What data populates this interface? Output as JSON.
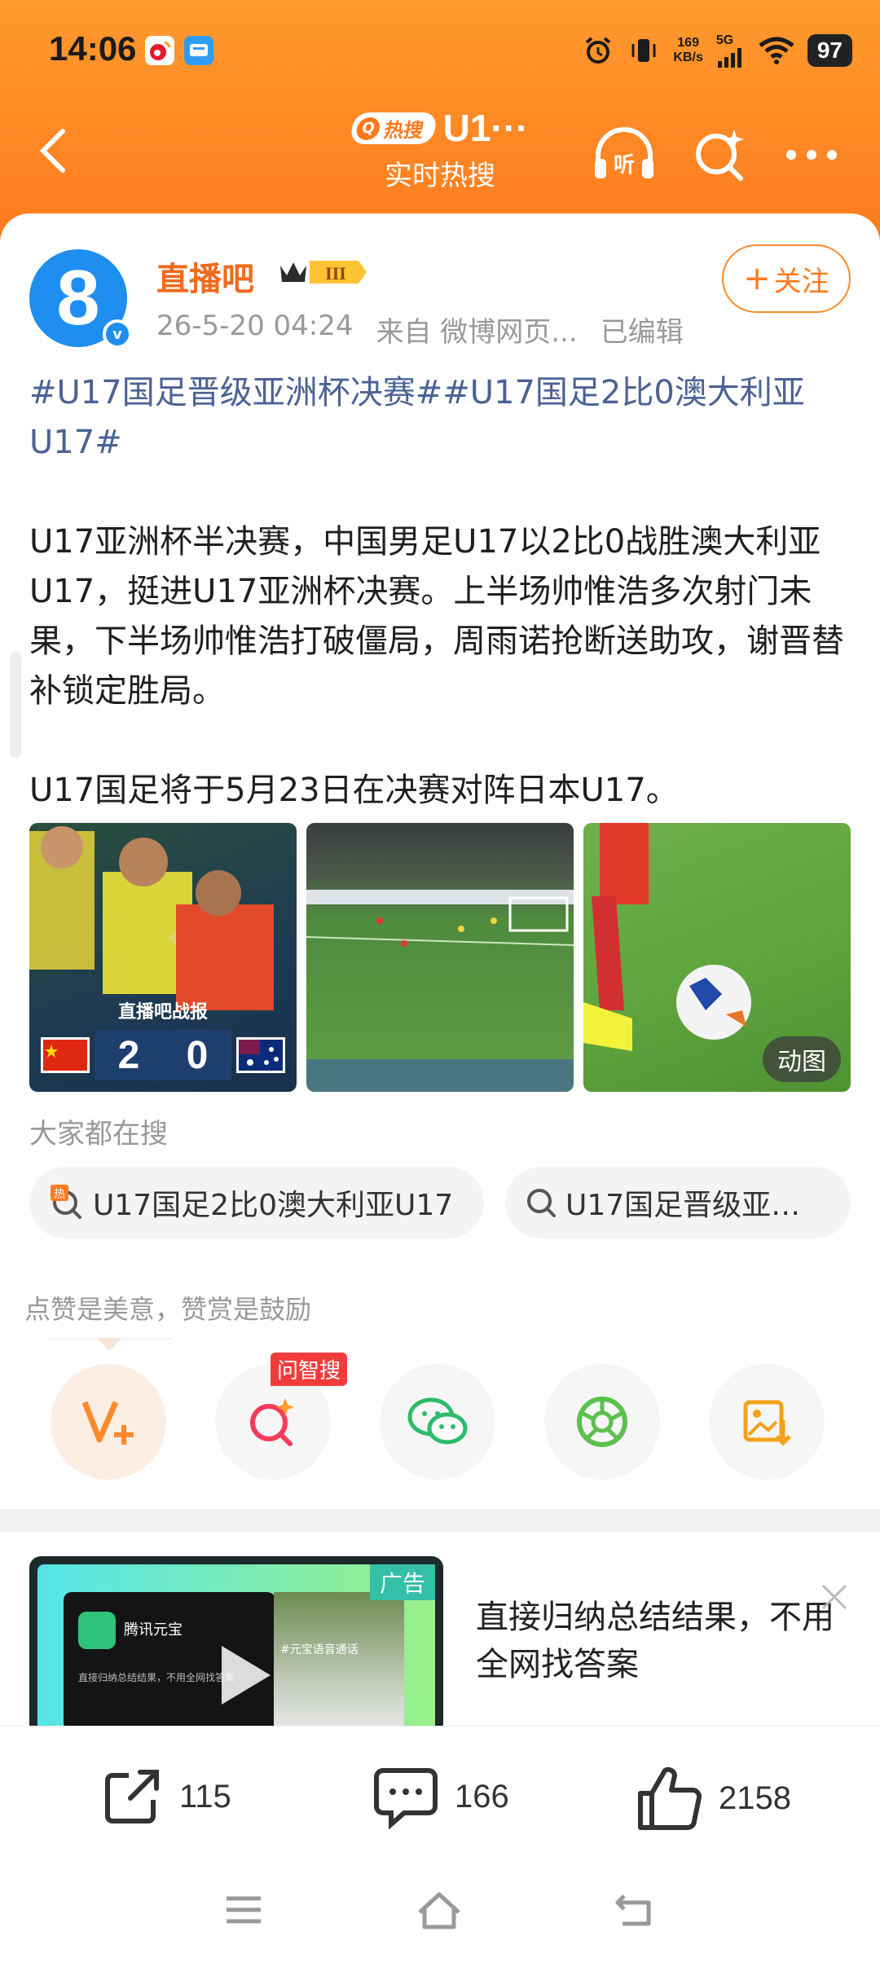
{
  "status_bar": {
    "time": "14:06",
    "net_speed_value": "169",
    "net_speed_unit": "KB/s",
    "net_type": "5G",
    "battery": "97"
  },
  "nav": {
    "hot_tag": "热搜",
    "title": "U1···",
    "subtitle": "实时热搜",
    "listen_label": "听"
  },
  "post": {
    "author": "直播吧",
    "badge_level": "III",
    "date": "26-5-20 04:24",
    "source": "来自 微博网页...",
    "edited": "已编辑",
    "follow_label": "关注",
    "topics": "#U17国足晋级亚洲杯决赛##U17国足2比0澳大利亚U17#",
    "paragraph1": "U17亚洲杯半决赛，中国男足U17以2比0战胜澳大利亚U17，挺进U17亚洲杯决赛。上半场帅惟浩多次射门未果，下半场帅惟浩打破僵局，周雨诺抢断送助攻，谢晋替补锁定胜局。",
    "paragraph2": "U17国足将于5月23日在决赛对阵日本U17。",
    "image1_caption": "直播吧战报",
    "image1_score_home": "2",
    "image1_score_away": "0",
    "image3_label": "动图"
  },
  "searches": {
    "title": "大家都在搜",
    "items": [
      "U17国足2比0澳大利亚U17",
      "U17国足晋级亚…"
    ],
    "hot_mark": "热"
  },
  "reward": {
    "text": "点赞是美意，赞赏是鼓励",
    "ask_badge": "问智搜"
  },
  "ad": {
    "label": "广告",
    "app_name": "腾讯元宝",
    "small_desc": "直接归纳总结结果，不用全网找答案",
    "photo_caption": "#元宝语音通话",
    "text": "直接归纳总结结果，不用全网找答案"
  },
  "bottom": {
    "share_count": "115",
    "comment_count": "166",
    "like_count": "2158"
  },
  "colors": {
    "header_orange": "#ff7a1e",
    "author_orange": "#f06a1d",
    "topic_blue": "#4b6294",
    "verified_blue": "#1e8ef0"
  }
}
